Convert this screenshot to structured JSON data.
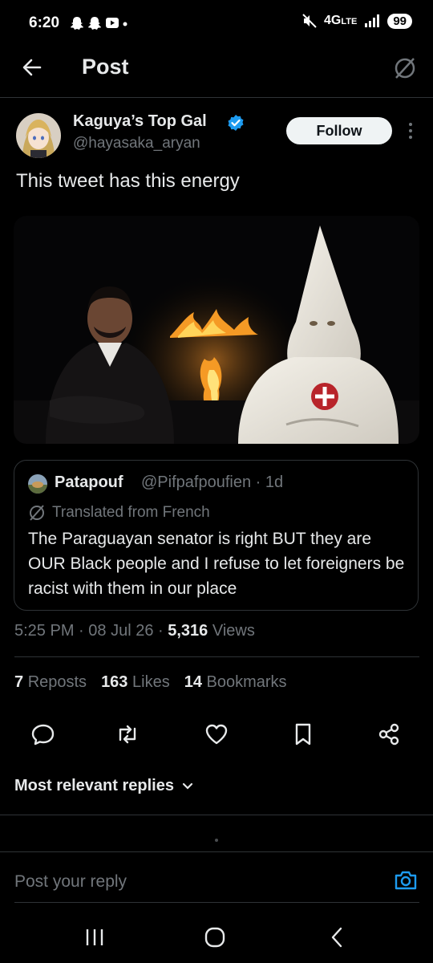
{
  "status_bar": {
    "time": "6:20",
    "network": "4G",
    "network_suffix": "LTE",
    "battery": "99",
    "left_icons": [
      "snapchat-icon",
      "snapchat-icon",
      "youtube-icon",
      "dot-icon"
    ],
    "right_icons": [
      "mute-icon",
      "signal-icon"
    ]
  },
  "header": {
    "title": "Post",
    "icons": [
      "back-arrow-icon",
      "translate-icon"
    ]
  },
  "post": {
    "author_name": "Kaguya’s Top Gal",
    "author_handle": "@hayasaka_aryan",
    "follow_label": "Follow",
    "text": "This tweet has this energy",
    "time": "5:25 PM",
    "date": "08 Jul 26",
    "views_count": "5,316",
    "views_label": "Views",
    "separator": "·"
  },
  "quote": {
    "author_name": "Patapouf",
    "author_handle": "@Pifpafpoufien",
    "age": "1d",
    "translated_label": "Translated from French",
    "text": "The Paraguayan senator is right BUT they are OUR Black people and I refuse to let foreigners be racist with them in our place"
  },
  "stats": {
    "reposts_count": "7",
    "reposts_label": "Reposts",
    "likes_count": "163",
    "likes_label": "Likes",
    "bookmarks_count": "14",
    "bookmarks_label": "Bookmarks"
  },
  "actions": [
    "reply-icon",
    "repost-icon",
    "like-icon",
    "bookmark-icon",
    "share-icon"
  ],
  "replies": {
    "sort_label": "Most relevant replies"
  },
  "composer": {
    "placeholder": "Post your reply"
  },
  "colors": {
    "background": "#000000",
    "text": "#e7e9ea",
    "muted": "#71767b",
    "accent": "#1d9bf0",
    "divider": "#2f3336"
  }
}
